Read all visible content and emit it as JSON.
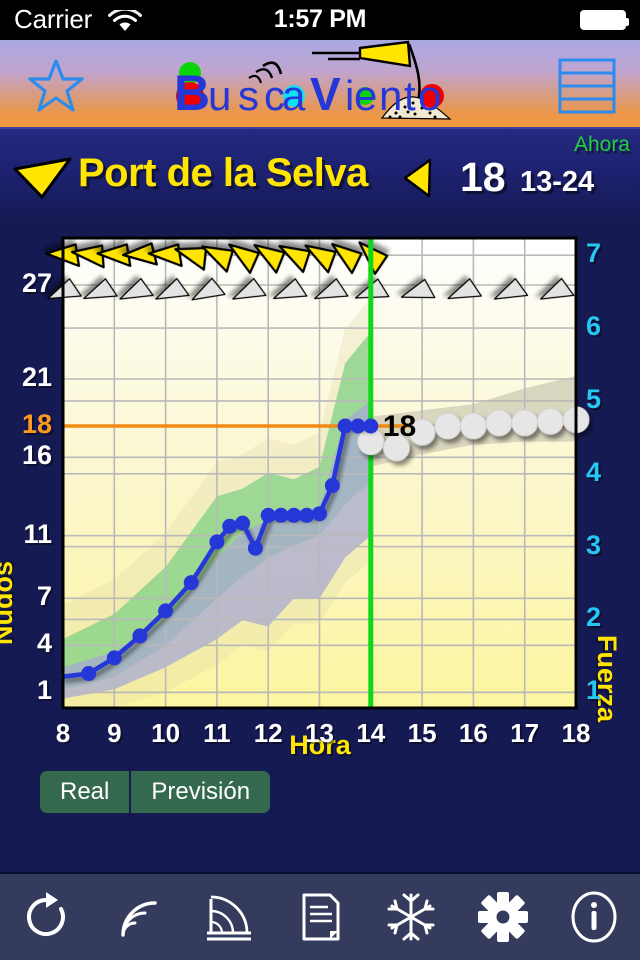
{
  "statusbar": {
    "carrier": "Carrier",
    "time": "1:57 PM",
    "wifi_icon": "wifi-icon",
    "battery_icon": "battery-icon"
  },
  "navbar": {
    "favorite_icon": "star-icon",
    "menu_icon": "menu-icon",
    "logo_text": "BuscaViento",
    "logo_letters": [
      "B",
      "u",
      "s",
      "c",
      "a",
      "V",
      "i",
      "e",
      "n",
      "t",
      "o"
    ]
  },
  "title": {
    "station": "Port de la Selva",
    "speed": "18",
    "range": "13-24",
    "now_label": "Ahora",
    "direction_icon": "wind-direction-arrow-icon"
  },
  "chart_data": {
    "type": "line",
    "title": "Port de la Selva",
    "xlabel": "Hora",
    "ylabel": "Nudos",
    "ylabel_right": "Fuerza",
    "xlim": [
      8,
      18
    ],
    "ylim": [
      0,
      30
    ],
    "xticks": [
      8,
      9,
      10,
      11,
      12,
      13,
      14,
      15,
      16,
      17,
      18
    ],
    "yticks_left": [
      1,
      4,
      7,
      11,
      16,
      21,
      27
    ],
    "yticks_right": [
      1,
      2,
      3,
      4,
      5,
      6,
      7
    ],
    "grid": true,
    "threshold_value": 18,
    "threshold_color": "#f08a12",
    "now_line_x": 14,
    "now_line_color": "#0fd81b",
    "series": [
      {
        "name": "Real",
        "color": "#2637d8",
        "x": [
          8.0,
          8.5,
          9.0,
          9.5,
          10.0,
          10.5,
          11.0,
          11.25,
          11.5,
          11.75,
          12.0,
          12.25,
          12.5,
          12.75,
          13.0,
          13.25,
          13.5,
          13.75,
          14.0
        ],
        "y": [
          2.0,
          2.2,
          3.2,
          4.6,
          6.2,
          8.0,
          10.6,
          11.6,
          11.8,
          10.2,
          12.3,
          12.3,
          12.3,
          12.3,
          12.4,
          14.2,
          18.0,
          18.0,
          18.0
        ]
      },
      {
        "name": "Previsión",
        "color": "#cfcfcf",
        "x": [
          14.0,
          14.5,
          15.0,
          15.5,
          16.0,
          16.5,
          17.0,
          17.5,
          18.0
        ],
        "y": [
          17.0,
          16.6,
          17.6,
          18.0,
          18.0,
          18.2,
          18.2,
          18.3,
          18.4
        ]
      }
    ],
    "band_green": {
      "name": "gust-band",
      "color": "#5fd07a",
      "x": [
        8.0,
        9.0,
        10.0,
        11.0,
        11.5,
        12.0,
        12.5,
        13.0,
        13.5,
        14.0
      ],
      "upper": [
        4.4,
        6.0,
        9.0,
        13.5,
        14.0,
        15.0,
        14.6,
        15.4,
        22.0,
        24.0
      ],
      "lower": [
        1.2,
        2.0,
        4.0,
        7.0,
        8.4,
        9.6,
        10.4,
        11.0,
        13.0,
        14.5
      ]
    },
    "band_blue": {
      "name": "lull-band",
      "color": "#8f93e8",
      "x": [
        8.0,
        9.0,
        10.0,
        11.0,
        11.5,
        12.0,
        12.5,
        13.0,
        13.5,
        14.0
      ],
      "upper": [
        2.6,
        3.6,
        5.6,
        9.6,
        11.2,
        12.0,
        12.6,
        12.8,
        18.4,
        19.6
      ],
      "lower": [
        0.6,
        1.2,
        2.6,
        4.4,
        5.6,
        5.2,
        7.0,
        7.0,
        9.6,
        11.0
      ]
    },
    "band_forecast": {
      "name": "forecast-band",
      "color": "#cfcbb6",
      "x": [
        14.0,
        15.0,
        16.0,
        17.0,
        18.0
      ],
      "upper": [
        18.6,
        19.0,
        19.4,
        20.4,
        21.2
      ],
      "lower": [
        15.4,
        16.2,
        16.8,
        17.0,
        17.0
      ]
    },
    "wind_arrows_real": {
      "label": "real-wind-direction-arrows",
      "color": "#ffe500",
      "x": [
        8.0,
        8.5,
        9.0,
        9.5,
        10.0,
        10.5,
        11.0,
        11.5,
        12.0,
        12.5,
        13.0,
        13.5,
        14.0
      ],
      "angle": [
        185,
        190,
        185,
        180,
        185,
        200,
        210,
        218,
        216,
        212,
        214,
        220,
        228
      ]
    },
    "wind_arrows_forecast": {
      "label": "forecast-wind-direction-arrows",
      "color": "#e3e3e3",
      "x": [
        8.0,
        8.7,
        9.4,
        10.1,
        10.8,
        11.6,
        12.4,
        13.2,
        14.0,
        14.9,
        15.8,
        16.7,
        17.6
      ],
      "angle": [
        160,
        160,
        158,
        158,
        155,
        158,
        160,
        160,
        162,
        165,
        160,
        158,
        158
      ]
    },
    "annotation": {
      "text": "18",
      "x": 14.0,
      "y": 18.0
    }
  },
  "segmented": {
    "options": [
      "Real",
      "Previsión"
    ],
    "selected": "Real"
  },
  "toolbar": {
    "items": [
      {
        "name": "refresh-icon",
        "label": "Actualizar"
      },
      {
        "name": "wind-waves-icon",
        "label": "Viento"
      },
      {
        "name": "radar-arc-icon",
        "label": "Radar"
      },
      {
        "name": "document-icon",
        "label": "Informe"
      },
      {
        "name": "snowflake-icon",
        "label": "Nieve"
      },
      {
        "name": "gear-icon",
        "label": "Ajustes"
      },
      {
        "name": "info-icon",
        "label": "Info"
      }
    ]
  },
  "colors": {
    "background": "#151a52",
    "accent_yellow": "#ffe500",
    "accent_cyan": "#25c8f0",
    "threshold_orange": "#f08a12",
    "now_green": "#0fd81b",
    "series_blue": "#2637d8",
    "toolbar_bg": "#343b5c",
    "segment_green": "#35694e"
  }
}
